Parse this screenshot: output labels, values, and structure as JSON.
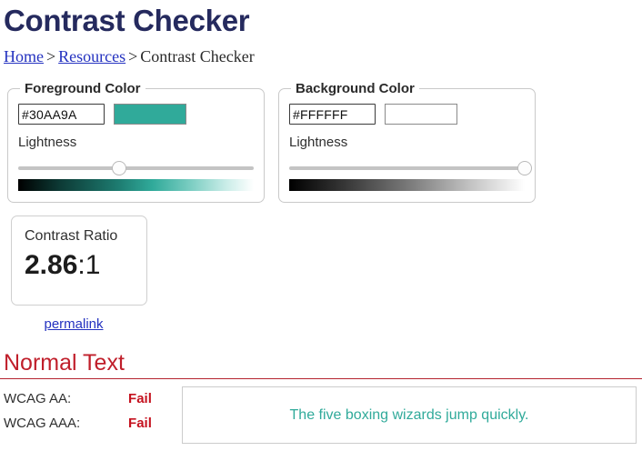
{
  "header": {
    "title": "Contrast Checker",
    "breadcrumb": {
      "home": "Home",
      "resources": "Resources",
      "current": "Contrast Checker",
      "separator": ">"
    }
  },
  "foreground": {
    "legend": "Foreground Color",
    "hex_value": "#30AA9A",
    "swatch_color": "#30AA9A",
    "lightness_label": "Lightness",
    "lightness_percent": 43
  },
  "background": {
    "legend": "Background Color",
    "hex_value": "#FFFFFF",
    "swatch_color": "#FFFFFF",
    "lightness_label": "Lightness",
    "lightness_percent": 100
  },
  "ratio": {
    "label": "Contrast Ratio",
    "value": "2.86",
    "suffix": ":1",
    "permalink_label": "permalink"
  },
  "results": {
    "section_title": "Normal Text",
    "rows": [
      {
        "label": "WCAG AA:",
        "result": "Fail"
      },
      {
        "label": "WCAG AAA:",
        "result": "Fail"
      }
    ],
    "sample_text": "The five boxing wizards jump quickly."
  },
  "colors": {
    "title_navy": "#252a5e",
    "link_blue": "#2432c0",
    "fail_red": "#c5121f",
    "section_red": "#c01f2b",
    "teal": "#30AA9A"
  }
}
